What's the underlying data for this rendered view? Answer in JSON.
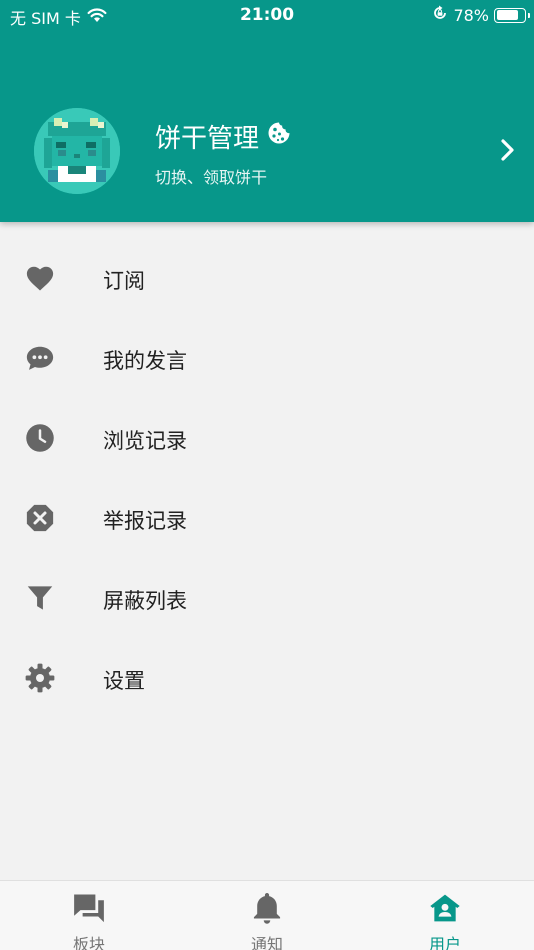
{
  "status_bar": {
    "carrier": "无 SIM 卡",
    "time": "21:00",
    "battery_text": "78%",
    "battery_level": 0.78
  },
  "profile": {
    "name": "饼干管理",
    "subtitle": "切换、领取饼干"
  },
  "menu": {
    "items": [
      {
        "label": "订阅",
        "icon": "heart-icon"
      },
      {
        "label": "我的发言",
        "icon": "chat-bubble-icon"
      },
      {
        "label": "浏览记录",
        "icon": "clock-icon"
      },
      {
        "label": "举报记录",
        "icon": "cancel-icon"
      },
      {
        "label": "屏蔽列表",
        "icon": "filter-icon"
      },
      {
        "label": "设置",
        "icon": "gear-icon"
      }
    ]
  },
  "tabs": [
    {
      "label": "板块",
      "icon": "forum-icon",
      "active": false
    },
    {
      "label": "通知",
      "icon": "bell-icon",
      "active": false
    },
    {
      "label": "用户",
      "icon": "user-home-icon",
      "active": true
    }
  ],
  "colors": {
    "primary": "#07978a",
    "icon_gray": "#666666",
    "background": "#f2f2f2",
    "avatar_bg": "#39c9b8"
  }
}
